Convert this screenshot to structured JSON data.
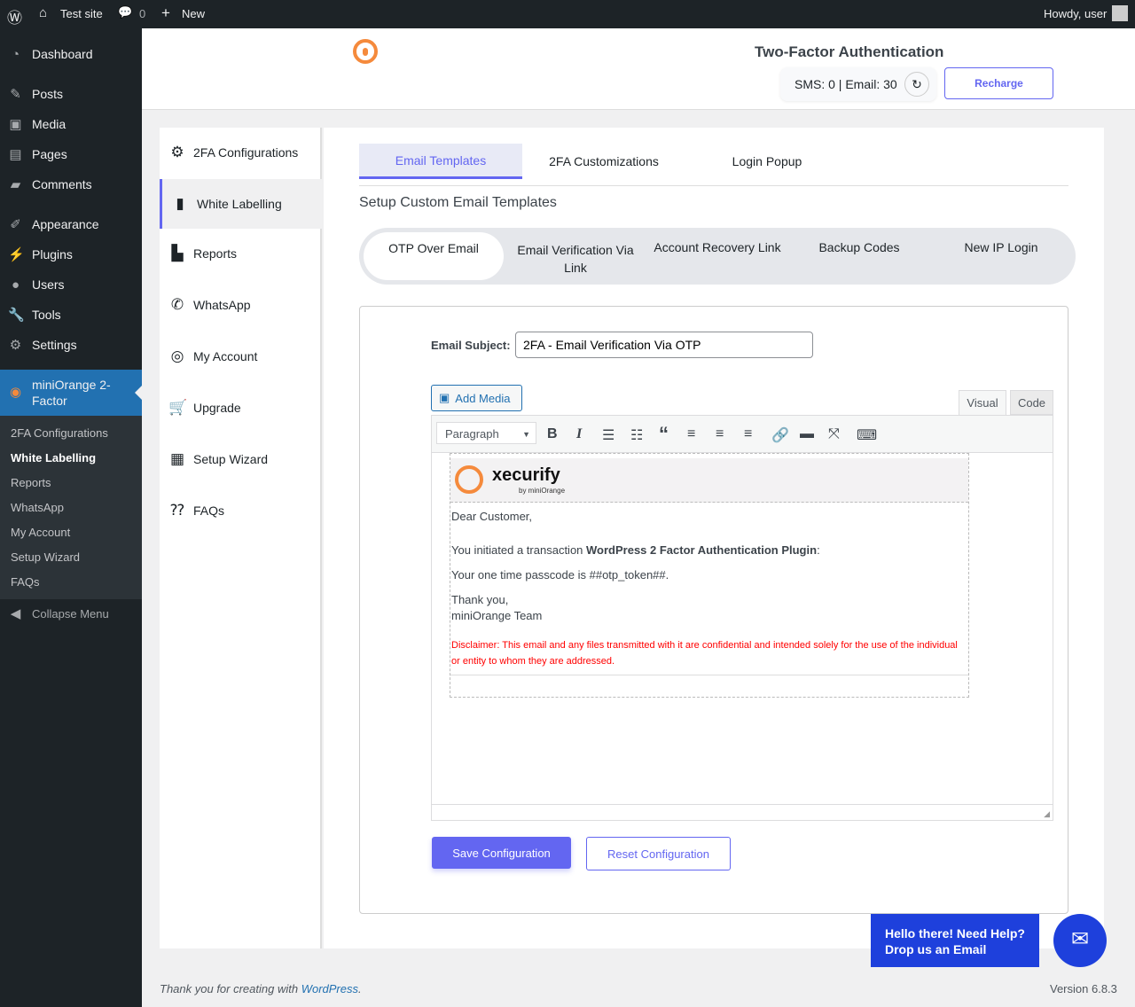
{
  "adminbar": {
    "site": "Test site",
    "comments": "0",
    "new": "New",
    "howdy": "Howdy, user"
  },
  "sidebar": {
    "items": [
      "Dashboard",
      "Posts",
      "Media",
      "Pages",
      "Comments",
      "Appearance",
      "Plugins",
      "Users",
      "Tools",
      "Settings"
    ],
    "active": "miniOrange 2-Factor",
    "submenu": [
      "2FA Configurations",
      "White Labelling",
      "Reports",
      "WhatsApp",
      "My Account",
      "Setup Wizard",
      "FAQs"
    ],
    "collapse": "Collapse Menu"
  },
  "header": {
    "title": "Two-Factor Authentication",
    "balance": "SMS: 0 | Email: 30",
    "recharge": "Recharge"
  },
  "leftnav": [
    "2FA Configurations",
    "White Labelling",
    "Reports",
    "WhatsApp",
    "My Account",
    "Upgrade",
    "Setup Wizard",
    "FAQs"
  ],
  "tabs": [
    "Email Templates",
    "2FA Customizations",
    "Login Popup"
  ],
  "section_title": "Setup Custom Email Templates",
  "subtabs": [
    "OTP Over Email",
    "Email Verification Via Link",
    "Account Recovery Link",
    "Backup Codes",
    "New IP Login"
  ],
  "form": {
    "subject_label": "Email Subject:",
    "subject_value": "2FA - Email Verification Via OTP",
    "add_media": "Add Media",
    "visual": "Visual",
    "code": "Code",
    "format": "Paragraph"
  },
  "email": {
    "brand": "xecurify",
    "brand_sub": "by miniOrange",
    "greeting": "Dear Customer,",
    "line1_pre": "You initiated a transaction ",
    "line1_bold": "WordPress 2 Factor Authentication Plugin",
    "line1_post": ":",
    "line2": "Your one time passcode is ##otp_token##.",
    "thanks": "Thank you,",
    "team": "miniOrange Team",
    "disclaimer": "Disclaimer: This email and any files transmitted with it are confidential and intended solely for the use of the individual or entity to whom they are addressed."
  },
  "buttons": {
    "save": "Save Configuration",
    "reset": "Reset Configuration"
  },
  "help": {
    "line1": "Hello there! Need Help?",
    "line2": "Drop us an Email"
  },
  "footer": {
    "thanks_pre": "Thank you for creating with ",
    "link": "WordPress",
    "thanks_post": ".",
    "version": "Version 6.8.3"
  },
  "colors": {
    "accent": "#6366f1",
    "wp_blue": "#2271b1",
    "disclaimer": "#ff0000",
    "help": "#1e40dc"
  }
}
